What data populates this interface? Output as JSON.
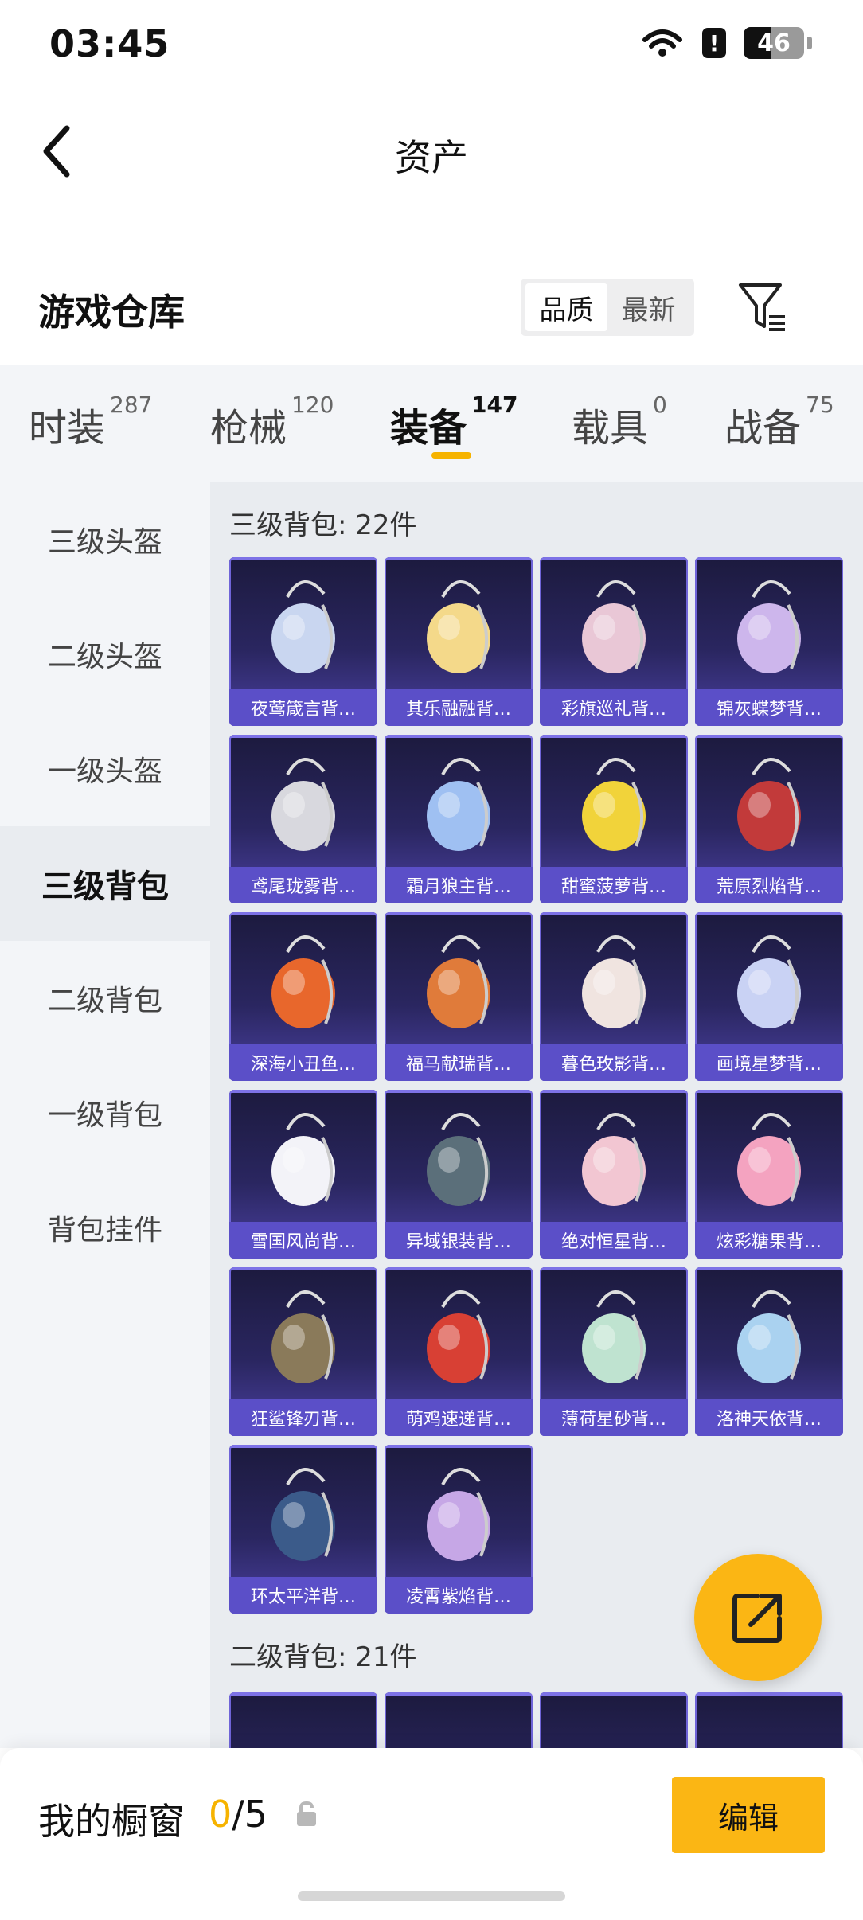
{
  "status": {
    "time": "03:45",
    "battery": "46",
    "alert": "!"
  },
  "header": {
    "title": "资产"
  },
  "section": {
    "title": "游戏仓库",
    "sort_options": [
      "品质",
      "最新"
    ],
    "active_sort": "品质"
  },
  "tabs": [
    {
      "label": "时装",
      "count": "287"
    },
    {
      "label": "枪械",
      "count": "120"
    },
    {
      "label": "装备",
      "count": "147"
    },
    {
      "label": "载具",
      "count": "0"
    },
    {
      "label": "战备",
      "count": "75"
    }
  ],
  "active_tab": "装备",
  "sidebar": {
    "items": [
      "三级头盔",
      "二级头盔",
      "一级头盔",
      "三级背包",
      "二级背包",
      "一级背包",
      "背包挂件"
    ],
    "active": "三级背包"
  },
  "groups": [
    {
      "title": "三级背包: 22件",
      "items": [
        "夜莺箴言背…",
        "其乐融融背…",
        "彩旗巡礼背…",
        "锦灰蝶梦背…",
        "鸢尾珑雾背…",
        "霜月狼主背…",
        "甜蜜菠萝背…",
        "荒原烈焰背…",
        "深海小丑鱼…",
        "福马献瑞背…",
        "暮色玫影背…",
        "画境星梦背…",
        "雪国风尚背…",
        "异域银装背…",
        "绝对恒星背…",
        "炫彩糖果背…",
        "狂鲨锋刃背…",
        "萌鸡速递背…",
        "薄荷星砂背…",
        "洛神天依背…",
        "环太平洋背…",
        "凌霄紫焰背…"
      ]
    },
    {
      "title": "二级背包: 21件",
      "items": [
        "",
        "",
        "",
        ""
      ]
    }
  ],
  "bottom": {
    "label": "我的橱窗",
    "count_current": "0",
    "count_total": "/5",
    "edit_label": "编辑"
  },
  "colors": {
    "accent": "#fbb614",
    "card_bar": "#5b4fc8",
    "card_bg": "#2a2660"
  },
  "icons": [
    "back-arrow-icon",
    "filter-icon",
    "share-icon",
    "lock-icon",
    "wifi-icon"
  ]
}
